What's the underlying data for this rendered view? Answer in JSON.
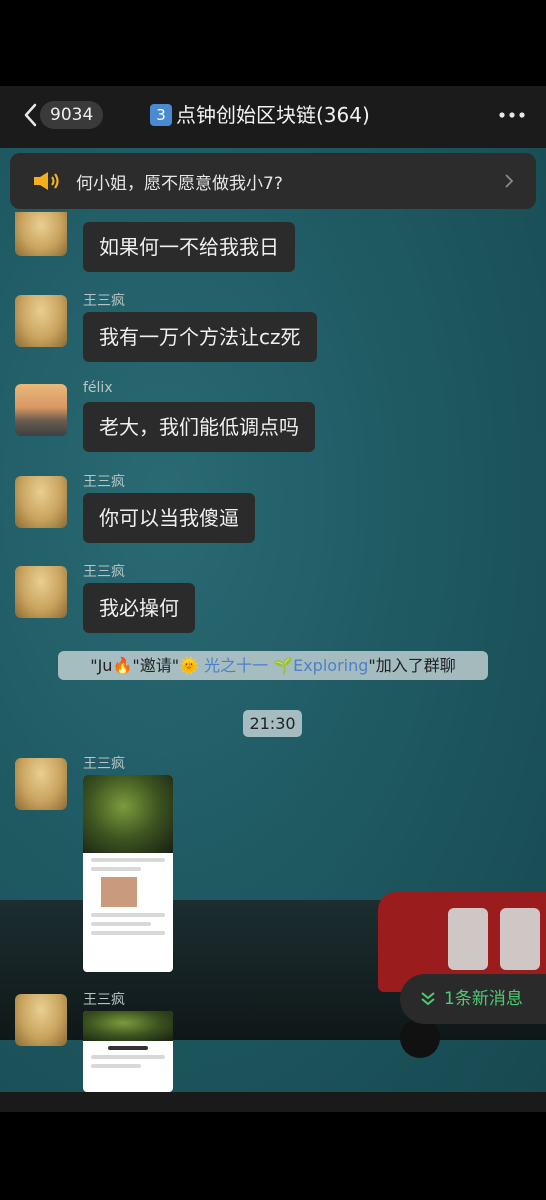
{
  "header": {
    "back_count": "9034",
    "title_num": "3",
    "title_text": "点钟创始区块链(364)"
  },
  "notice": {
    "text": "何小姐，愿不愿意做我小7?"
  },
  "messages": [
    {
      "sender": "",
      "text": "如果何一不给我我日"
    },
    {
      "sender": "王三疯",
      "text": "我有一万个方法让cz死"
    },
    {
      "sender": "félix",
      "text": "老大，我们能低调点吗"
    },
    {
      "sender": "王三疯",
      "text": "你可以当我傻逼"
    },
    {
      "sender": "王三疯",
      "text": "我必操何"
    }
  ],
  "system": {
    "part1": "\"Ju🔥\"邀请\"🌞 ",
    "part2": "光之十一 🌱Exploring",
    "part3": "\"加入了群聊"
  },
  "time": "21:30",
  "image_messages": [
    {
      "sender": "王三疯"
    },
    {
      "sender": "王三疯"
    }
  ],
  "new_messages": {
    "label": "1条新消息"
  },
  "colors": {
    "accent_green": "#4ecb71",
    "bubble": "#2b2b2b",
    "background": "#1f5a63"
  }
}
